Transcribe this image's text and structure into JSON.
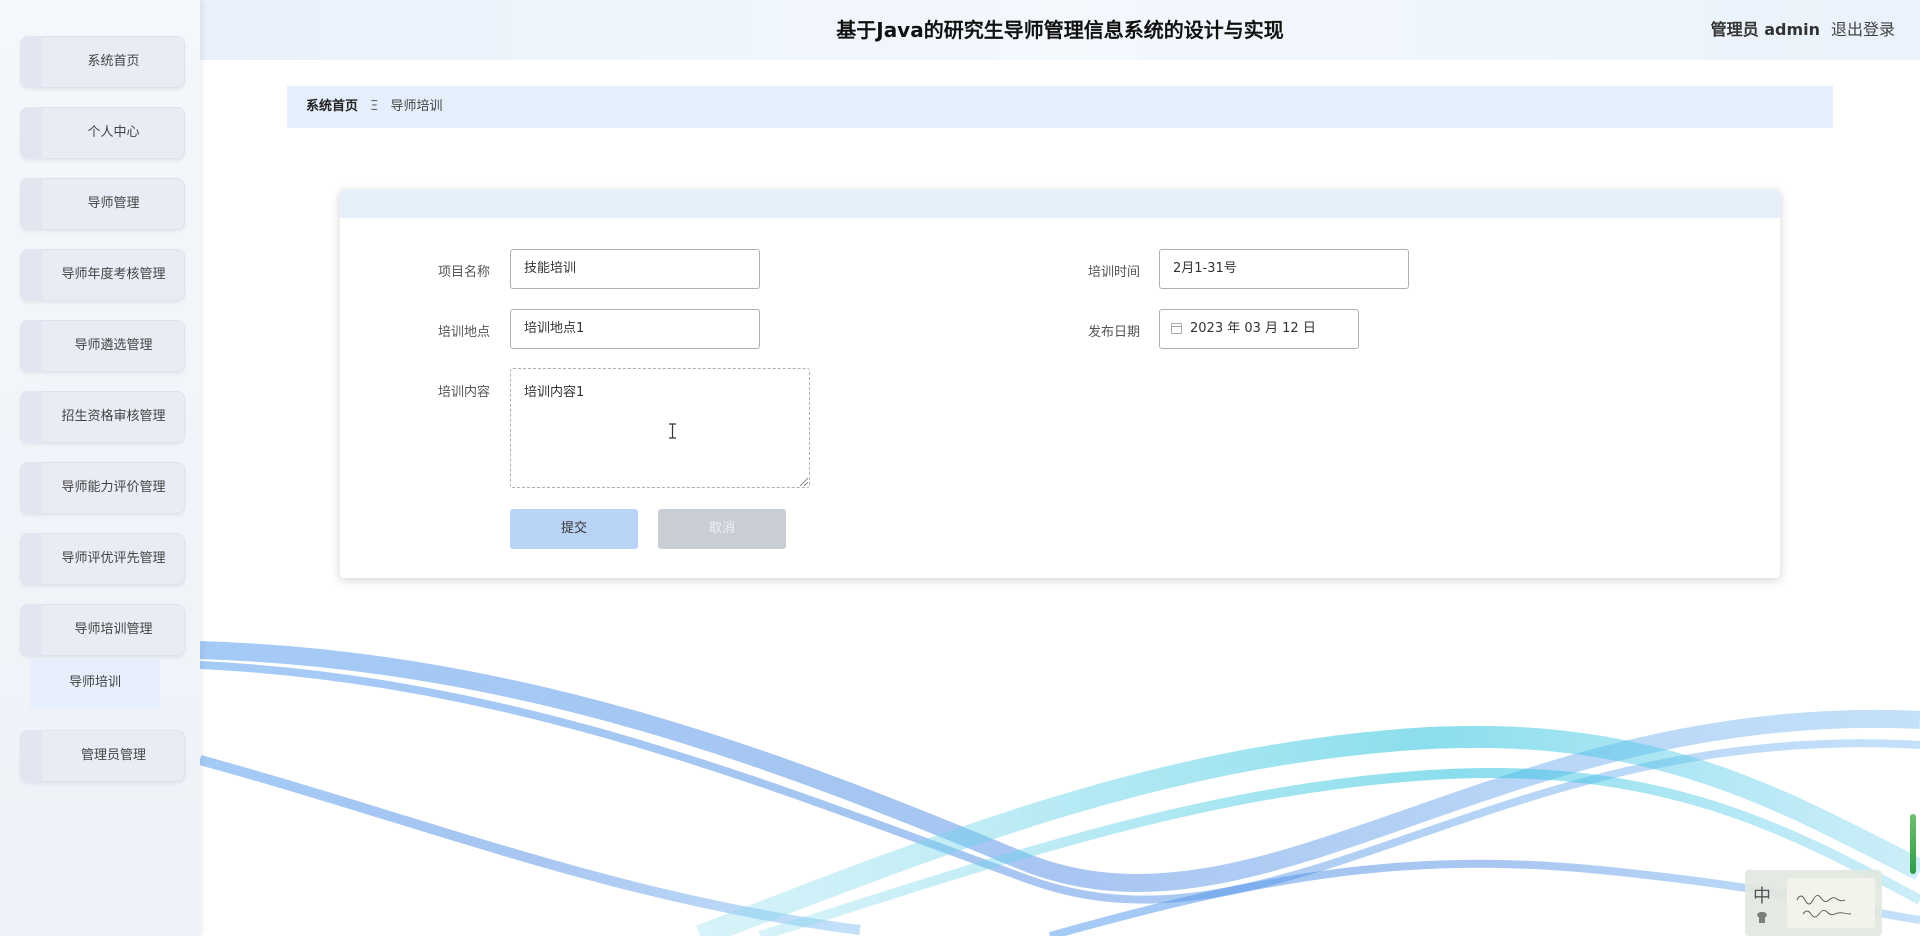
{
  "app": {
    "title": "基于Java的研究生导师管理信息系统的设计与实现",
    "user_label": "管理员 admin",
    "logout_label": "退出登录"
  },
  "sidebar": {
    "items": [
      {
        "label": "系统首页"
      },
      {
        "label": "个人中心"
      },
      {
        "label": "导师管理"
      },
      {
        "label": "导师年度考核管理"
      },
      {
        "label": "导师遴选管理"
      },
      {
        "label": "招生资格审核管理"
      },
      {
        "label": "导师能力评价管理"
      },
      {
        "label": "导师评优评先管理"
      },
      {
        "label": "导师培训管理"
      },
      {
        "label": "管理员管理"
      }
    ],
    "submenu": {
      "label": "导师培训"
    }
  },
  "breadcrumb": {
    "home": "系统首页",
    "separator": "Ξ",
    "current": "导师培训"
  },
  "form": {
    "project_name": {
      "label": "项目名称",
      "value": "技能培训"
    },
    "training_time": {
      "label": "培训时间",
      "value": "2月1-31号"
    },
    "training_location": {
      "label": "培训地点",
      "value": "培训地点1"
    },
    "publish_date": {
      "label": "发布日期",
      "value": "2023 年 03 月 12 日"
    },
    "training_content": {
      "label": "培训内容",
      "value": "培训内容1"
    },
    "submit_label": "提交",
    "cancel_label": "取消"
  },
  "ime": {
    "mode_char": "中"
  },
  "colors": {
    "accent": "#b9d3f7",
    "header_bg": "#e8f1fb",
    "breadcrumb_bg": "#e5effb",
    "wave_blue": "#4a90e8",
    "wave_cyan": "#3cc8e0"
  }
}
